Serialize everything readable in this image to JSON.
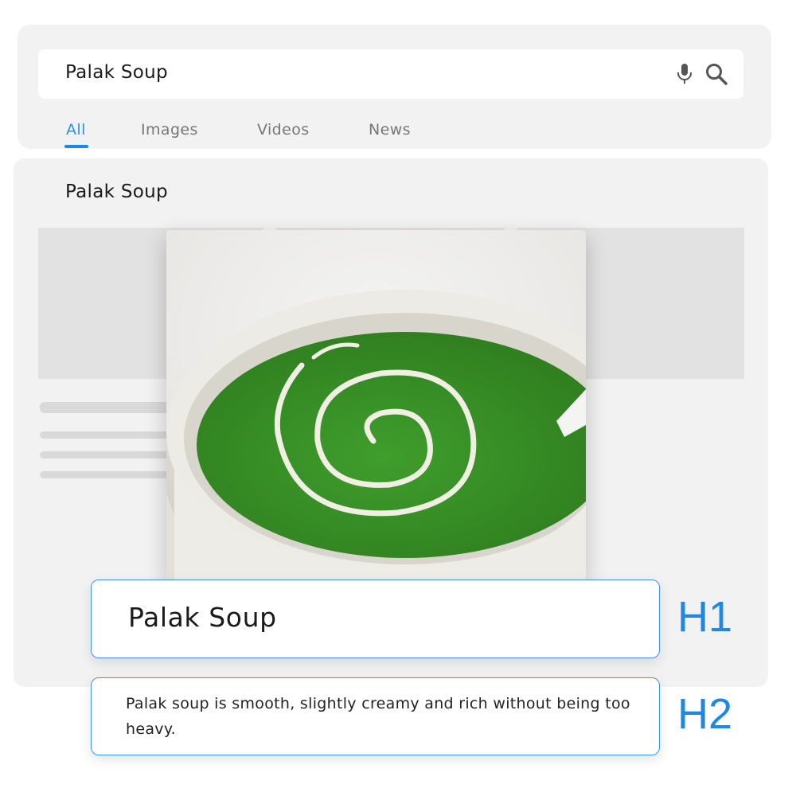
{
  "search": {
    "query": "Palak Soup",
    "tabs": [
      {
        "label": "All",
        "active": true
      },
      {
        "label": "Images",
        "active": false
      },
      {
        "label": "Videos",
        "active": false
      },
      {
        "label": "News",
        "active": false
      }
    ],
    "icons": [
      "microphone-icon",
      "search-icon"
    ]
  },
  "result": {
    "title": "Palak Soup",
    "image": "bowl of green palak soup with cream swirl"
  },
  "headings": {
    "h1": {
      "text": "Palak Soup",
      "label": "H1"
    },
    "h2": {
      "text": "Palak soup is smooth, slightly creamy and rich without being too heavy.",
      "label": "H2"
    }
  },
  "colors": {
    "accent": "#1e88e5",
    "card_bg": "#f2f2f2",
    "placeholder": "#e2e2e2"
  }
}
